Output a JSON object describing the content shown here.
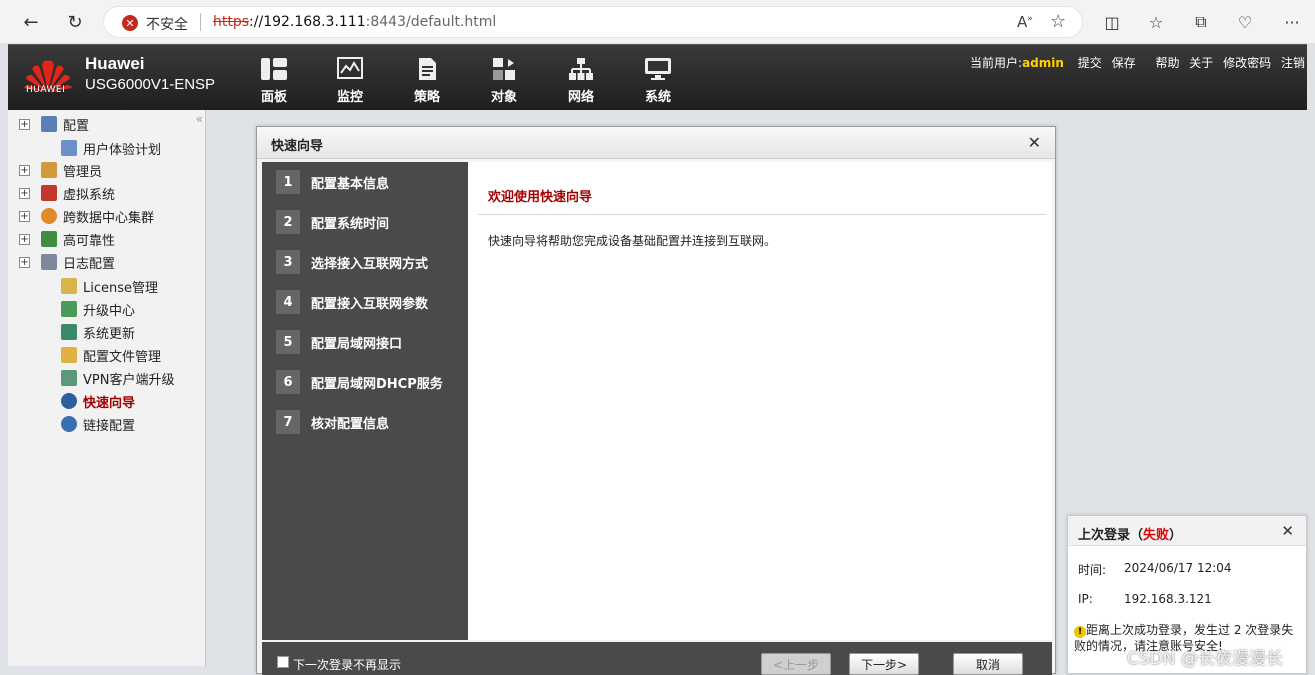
{
  "browser": {
    "insecure_label": "不安全",
    "url_protocol": "https",
    "url_host": "://192.168.3.111",
    "url_path": ":8443/default.html"
  },
  "header": {
    "logo_text": "HUAWEI",
    "brand": "Huawei",
    "model": "USG6000V1-ENSP",
    "nav": [
      "面板",
      "监控",
      "策略",
      "对象",
      "网络",
      "系统"
    ],
    "current_user_label": "当前用户:",
    "username": "admin",
    "links": [
      "提交",
      "保存",
      "帮助",
      "关于",
      "修改密码",
      "注销"
    ]
  },
  "sidebar": {
    "items": [
      {
        "label": "配置",
        "expandable": true
      },
      {
        "label": "用户体验计划",
        "expandable": false
      },
      {
        "label": "管理员",
        "expandable": true
      },
      {
        "label": "虚拟系统",
        "expandable": true
      },
      {
        "label": "跨数据中心集群",
        "expandable": true
      },
      {
        "label": "高可靠性",
        "expandable": true
      },
      {
        "label": "日志配置",
        "expandable": true
      },
      {
        "label": "License管理",
        "expandable": false
      },
      {
        "label": "升级中心",
        "expandable": false
      },
      {
        "label": "系统更新",
        "expandable": false
      },
      {
        "label": "配置文件管理",
        "expandable": false
      },
      {
        "label": "VPN客户端升级",
        "expandable": false
      },
      {
        "label": "快速向导",
        "expandable": false,
        "active": true
      },
      {
        "label": "链接配置",
        "expandable": false
      }
    ]
  },
  "wizard": {
    "title": "快速向导",
    "steps": [
      {
        "num": "1",
        "label": "配置基本信息"
      },
      {
        "num": "2",
        "label": "配置系统时间"
      },
      {
        "num": "3",
        "label": "选择接入互联网方式"
      },
      {
        "num": "4",
        "label": "配置接入互联网参数"
      },
      {
        "num": "5",
        "label": "配置局域网接口"
      },
      {
        "num": "6",
        "label": "配置局域网DHCP服务"
      },
      {
        "num": "7",
        "label": "核对配置信息"
      }
    ],
    "welcome": "欢迎使用快速向导",
    "description": "快速向导将帮助您完成设备基础配置并连接到互联网。",
    "dont_show_label": "下一次登录不再显示",
    "prev_label": "<上一步",
    "next_label": "下一步>",
    "cancel_label": "取消"
  },
  "last_login": {
    "title_prefix": "上次登录（",
    "title_status": "失败",
    "title_suffix": "）",
    "time_label": "时间:",
    "time_value": "2024/06/17 12:04",
    "ip_label": "IP:",
    "ip_value": "192.168.3.121",
    "warning": "距离上次成功登录，发生过 2 次登录失败的情况，请注意账号安全!"
  },
  "watermark": "CSDN @长夜漫漫长",
  "colors": {
    "accent_red": "#a30000",
    "header_bg": "#2a2a2a",
    "wizard_steps_bg": "#4a4a4a",
    "username": "#ffd200"
  }
}
